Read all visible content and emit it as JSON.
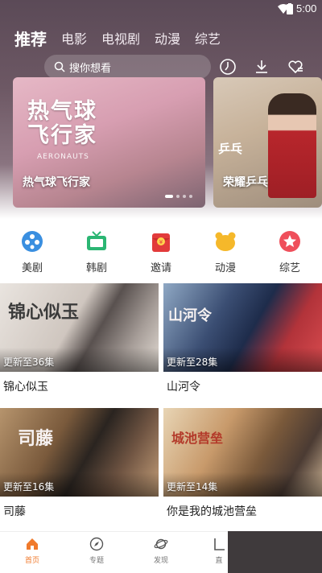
{
  "status": {
    "time": "5:00"
  },
  "tabs": [
    "推荐",
    "电影",
    "电视剧",
    "动漫",
    "综艺"
  ],
  "search": {
    "placeholder": "搜你想看"
  },
  "top_icons": [
    "history-icon",
    "download-icon",
    "favorites-icon"
  ],
  "banner": {
    "main": {
      "art_title_line1": "热气球",
      "art_title_line2": "飞行家",
      "art_sub": "AERONAUTS",
      "label": "热气球飞行家"
    },
    "side": {
      "art_title": "乒乓",
      "label": "荣耀乒乓"
    }
  },
  "categories": [
    {
      "label": "美剧",
      "icon": "film-reel-icon",
      "color": "#3a8fe0"
    },
    {
      "label": "韩剧",
      "icon": "tv-icon",
      "color": "#2bb673"
    },
    {
      "label": "邀请",
      "icon": "red-envelope-icon",
      "color": "#e23b3b"
    },
    {
      "label": "动漫",
      "icon": "bear-icon",
      "color": "#f5b82a"
    },
    {
      "label": "综艺",
      "icon": "star-icon",
      "color": "#ef4f5b"
    }
  ],
  "videos": [
    {
      "title": "锦心似玉",
      "episode": "更新至36集",
      "poster_text": "锦心似玉"
    },
    {
      "title": "山河令",
      "episode": "更新至28集",
      "poster_text": "山河令"
    },
    {
      "title": "司藤",
      "episode": "更新至16集",
      "poster_text": "司藤"
    },
    {
      "title": "你是我的城池营垒",
      "episode": "更新至14集",
      "poster_text": "城池营垒"
    }
  ],
  "bottom_nav": [
    {
      "label": "首页",
      "active": true
    },
    {
      "label": "专题",
      "active": false
    },
    {
      "label": "发现",
      "active": false
    },
    {
      "label": "直",
      "active": false
    }
  ],
  "colors": {
    "accent": "#f07a2c"
  }
}
